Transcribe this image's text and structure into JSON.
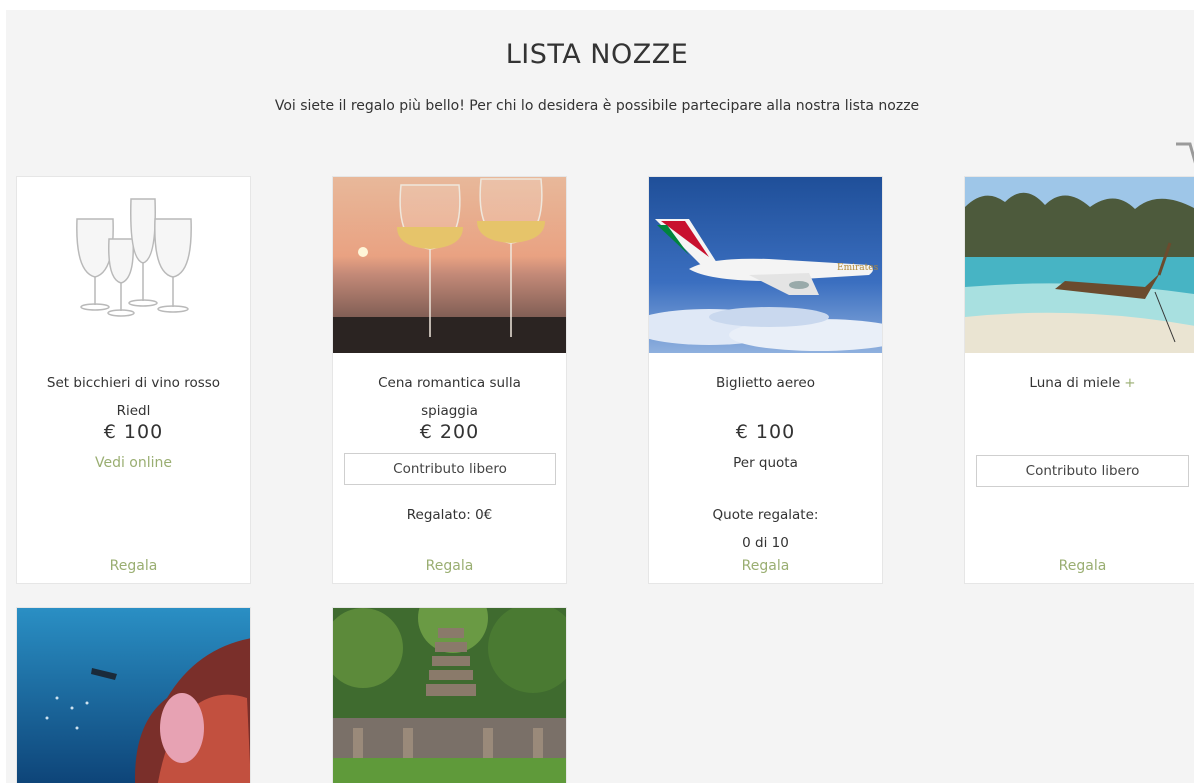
{
  "header": {
    "title": "LISTA NOZZE",
    "subtitle": "Voi siete il regalo più bello! Per chi lo desidera è possibile partecipare alla nostra lista nozze"
  },
  "gifts": [
    {
      "name_line1": "Set bicchieri di vino rosso",
      "name_line2": "Riedl",
      "price": "€  100",
      "link": "Vedi online",
      "cta": "Regala"
    },
    {
      "name_line1": "Cena romantica sulla",
      "name_line2": "spiaggia",
      "price": "€  200",
      "contribution_placeholder": "Contributo libero",
      "gifted": "Regalato: 0€",
      "cta": "Regala"
    },
    {
      "name_line1": "Biglietto aereo",
      "price": "€  100",
      "per_share": "Per quota",
      "shares_label": "Quote regalate:",
      "shares_value": "0 di 10",
      "cta": "Regala",
      "airline_text": "Emirates"
    },
    {
      "name_line1": "Luna di miele",
      "expand_symbol": "+",
      "contribution_placeholder": "Contributo libero",
      "cta": "Regala"
    }
  ],
  "colors": {
    "accent": "#9aae72",
    "background": "#f4f4f4"
  }
}
